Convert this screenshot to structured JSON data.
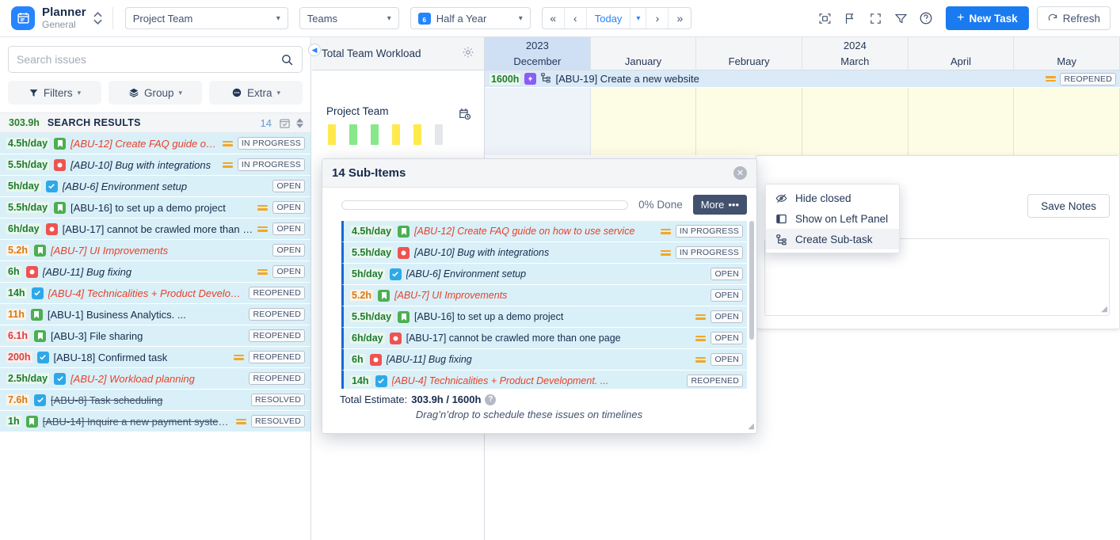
{
  "topbar": {
    "app_title": "Planner",
    "app_subtitle": "General",
    "project_select": "Project Team",
    "teams_select": "Teams",
    "range_select": "Half a Year",
    "range_icon_text": "6",
    "nav": {
      "first": "«",
      "prev": "‹",
      "today": "Today",
      "next": "›",
      "last": "»"
    },
    "icons": [
      "scan-icon",
      "flag-icon",
      "fullscreen-icon",
      "filter-icon",
      "help-icon"
    ],
    "new_task": "New Task",
    "refresh": "Refresh"
  },
  "left_panel": {
    "search_placeholder": "Search issues",
    "search_value": "",
    "buttons": [
      {
        "label": "Filters",
        "icon": "filter-icon"
      },
      {
        "label": "Group",
        "icon": "layers-icon"
      },
      {
        "label": "Extra",
        "icon": "dots-circle-icon"
      }
    ],
    "results_header": {
      "hours": "303.9h",
      "title": "SEARCH RESULTS",
      "count": "14"
    },
    "issues": [
      {
        "hours": "4.5h/day",
        "hours_color": "green",
        "type": "story",
        "text": "[ABU-12] Create FAQ guide on ho...",
        "style": "red",
        "priority": true,
        "status": "IN PROGRESS"
      },
      {
        "hours": "5.5h/day",
        "hours_color": "green",
        "type": "bug",
        "text": "[ABU-10] Bug with integrations",
        "style": "ital",
        "priority": true,
        "status": "IN PROGRESS"
      },
      {
        "hours": "5h/day",
        "hours_color": "green",
        "type": "task",
        "text": "[ABU-6] Environment setup",
        "style": "ital",
        "priority": false,
        "status": "OPEN"
      },
      {
        "hours": "5.5h/day",
        "hours_color": "green",
        "type": "story",
        "text": "[ABU-16] to set up a demo project",
        "style": "",
        "priority": true,
        "status": "OPEN"
      },
      {
        "hours": "6h/day",
        "hours_color": "green",
        "type": "bug",
        "text": "[ABU-17] cannot be crawled more than o...",
        "style": "",
        "priority": true,
        "status": "OPEN"
      },
      {
        "hours": "5.2h",
        "hours_color": "orange",
        "type": "story",
        "text": "[ABU-7] UI Improvements",
        "style": "red",
        "priority": false,
        "status": "OPEN"
      },
      {
        "hours": "6h",
        "hours_color": "green",
        "type": "bug",
        "text": "[ABU-11] Bug fixing",
        "style": "ital",
        "priority": true,
        "status": "OPEN"
      },
      {
        "hours": "14h",
        "hours_color": "green",
        "type": "task",
        "text": "[ABU-4] Technicalities + Product Develop...",
        "style": "red",
        "priority": false,
        "status": "REOPENED"
      },
      {
        "hours": "11h",
        "hours_color": "orange",
        "type": "story",
        "text": "[ABU-1] Business Analytics. ...",
        "style": "",
        "priority": false,
        "status": "REOPENED"
      },
      {
        "hours": "6.1h",
        "hours_color": "red",
        "type": "story",
        "text": "[ABU-3] File sharing",
        "style": "",
        "priority": false,
        "status": "REOPENED"
      },
      {
        "hours": "200h",
        "hours_color": "red",
        "type": "task",
        "text": "[ABU-18] Confirmed task",
        "style": "",
        "priority": true,
        "status": "REOPENED"
      },
      {
        "hours": "2.5h/day",
        "hours_color": "green",
        "type": "task",
        "text": "[ABU-2] Workload planning",
        "style": "red",
        "priority": false,
        "status": "REOPENED"
      },
      {
        "hours": "7.6h",
        "hours_color": "orange",
        "type": "task",
        "text": "[ABU-8] Task scheduling",
        "style": "strike",
        "priority": false,
        "status": "RESOLVED"
      },
      {
        "hours": "1h",
        "hours_color": "green",
        "type": "story",
        "text": "[ABU-14] Inquire a new payment system o...",
        "style": "strike",
        "priority": true,
        "status": "RESOLVED"
      }
    ]
  },
  "timeline": {
    "panel_title": "Total Team Workload",
    "team_name": "Project Team",
    "year_left": "2023",
    "year_right": "2024",
    "months": [
      {
        "name": "December",
        "current": true
      },
      {
        "name": "January",
        "current": false
      },
      {
        "name": "February",
        "current": false
      },
      {
        "name": "March",
        "current": false
      },
      {
        "name": "April",
        "current": false
      },
      {
        "name": "May",
        "current": false
      }
    ],
    "epic_row": {
      "hours": "1600h",
      "text": "[ABU-19] Create a new website",
      "status": "REOPENED"
    },
    "workload_bars": [
      {
        "color": "#ffe94d"
      },
      {
        "color": "#86e88a"
      },
      {
        "color": "#86e88a"
      },
      {
        "color": "#ffe94d"
      },
      {
        "color": "#ffe94d"
      },
      {
        "color": "#e4e6ea"
      }
    ]
  },
  "notes_panel": {
    "save_label": "Save Notes",
    "notes_value": ""
  },
  "modal": {
    "title": "14 Sub-Items",
    "progress_label": "0% Done",
    "progress_percent": 0,
    "more_label": "More",
    "total_estimate_label": "Total Estimate:",
    "total_estimate_value": "303.9h / 1600h",
    "hint": "Drag’n’drop to schedule these issues on timelines",
    "rows": [
      {
        "hours": "4.5h/day",
        "hours_color": "green",
        "type": "story",
        "text": "[ABU-12] Create FAQ guide on how to use service",
        "style": "red",
        "priority": true,
        "status": "IN PROGRESS"
      },
      {
        "hours": "5.5h/day",
        "hours_color": "green",
        "type": "bug",
        "text": "[ABU-10] Bug with integrations",
        "style": "ital",
        "priority": true,
        "status": "IN PROGRESS"
      },
      {
        "hours": "5h/day",
        "hours_color": "green",
        "type": "task",
        "text": "[ABU-6] Environment setup",
        "style": "ital",
        "priority": false,
        "status": "OPEN"
      },
      {
        "hours": "5.2h",
        "hours_color": "orange",
        "type": "story",
        "text": "[ABU-7] UI Improvements",
        "style": "red",
        "priority": false,
        "status": "OPEN"
      },
      {
        "hours": "5.5h/day",
        "hours_color": "green",
        "type": "story",
        "text": "[ABU-16] to set up a demo project",
        "style": "",
        "priority": true,
        "status": "OPEN"
      },
      {
        "hours": "6h/day",
        "hours_color": "green",
        "type": "bug",
        "text": "[ABU-17] cannot be crawled more than one page",
        "style": "",
        "priority": true,
        "status": "OPEN"
      },
      {
        "hours": "6h",
        "hours_color": "green",
        "type": "bug",
        "text": "[ABU-11] Bug fixing",
        "style": "ital",
        "priority": true,
        "status": "OPEN"
      },
      {
        "hours": "14h",
        "hours_color": "green",
        "type": "task",
        "text": "[ABU-4] Technicalities + Product Development. ...",
        "style": "red",
        "priority": false,
        "status": "REOPENED"
      }
    ]
  },
  "context_menu": {
    "items": [
      {
        "label": "Hide closed",
        "icon": "eye-off-icon",
        "hover": false
      },
      {
        "label": "Show on Left Panel",
        "icon": "panel-icon",
        "hover": false
      },
      {
        "label": "Create Sub-task",
        "icon": "subtask-tree-icon",
        "hover": true
      }
    ]
  },
  "colors": {
    "accent": "#2684ff",
    "primary_button": "#1a7bf0",
    "row_bg": "#d9f0f8",
    "epic": "#8b5cf6"
  }
}
